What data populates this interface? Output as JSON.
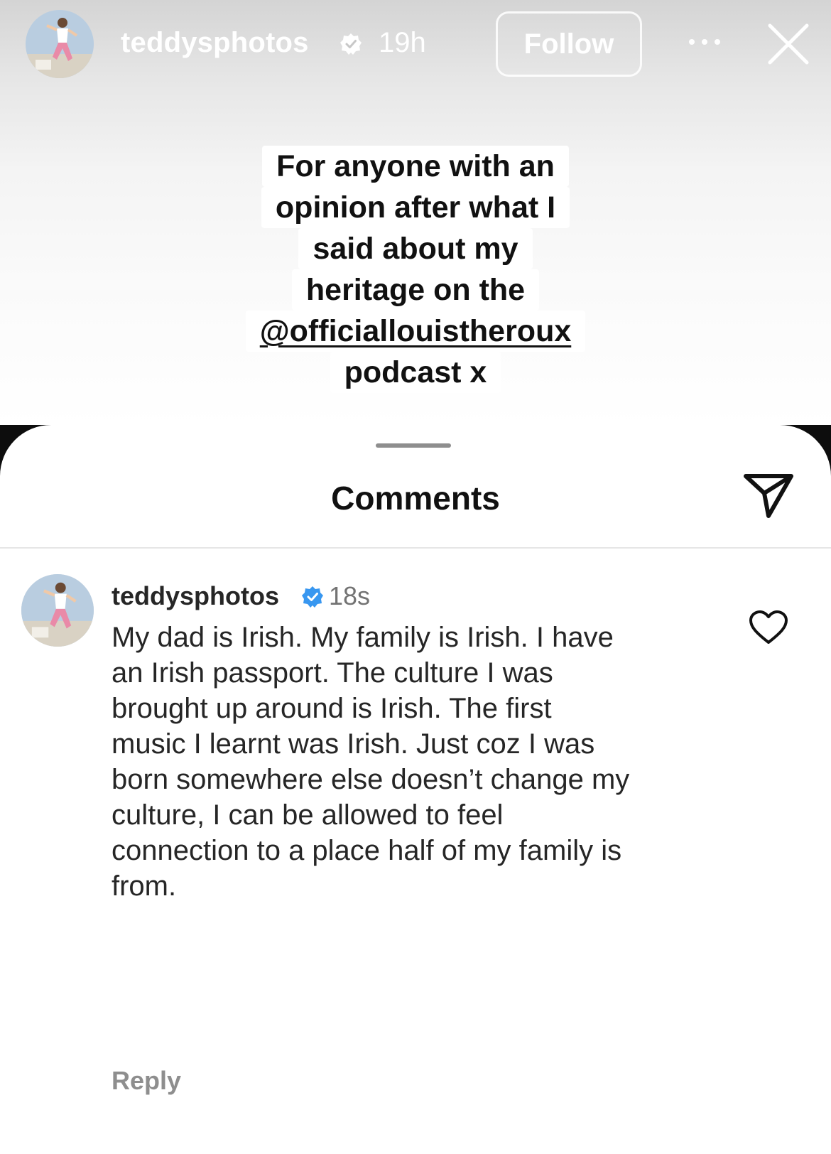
{
  "story": {
    "username": "teddysphotos",
    "time_ago": "19h",
    "follow_label": "Follow",
    "more_icon": "more-horizontal-icon",
    "close_icon": "close-icon",
    "caption_lines": [
      "For anyone with an",
      "opinion after what I",
      "said about my",
      "heritage on the",
      "@officiallouistheroux",
      "podcast x"
    ]
  },
  "comments_sheet": {
    "title": "Comments",
    "share_icon": "send-icon",
    "comment": {
      "username": "teddysphotos",
      "time_ago": "18s",
      "lines": [
        "My dad is Irish. My family is Irish. I have",
        "an Irish passport. The culture I was",
        "brought up around is Irish. The first",
        "music I learnt was Irish. Just coz I was",
        "born somewhere else doesn’t change my",
        "culture, I can be allowed to feel",
        "connection to a place half of my family is",
        "from."
      ],
      "reply_label": "Reply",
      "like_icon": "heart-outline-icon"
    }
  },
  "colors": {
    "verified_badge": "#3897f0",
    "muted_text": "#8e8e8e",
    "primary_text": "#262626"
  }
}
